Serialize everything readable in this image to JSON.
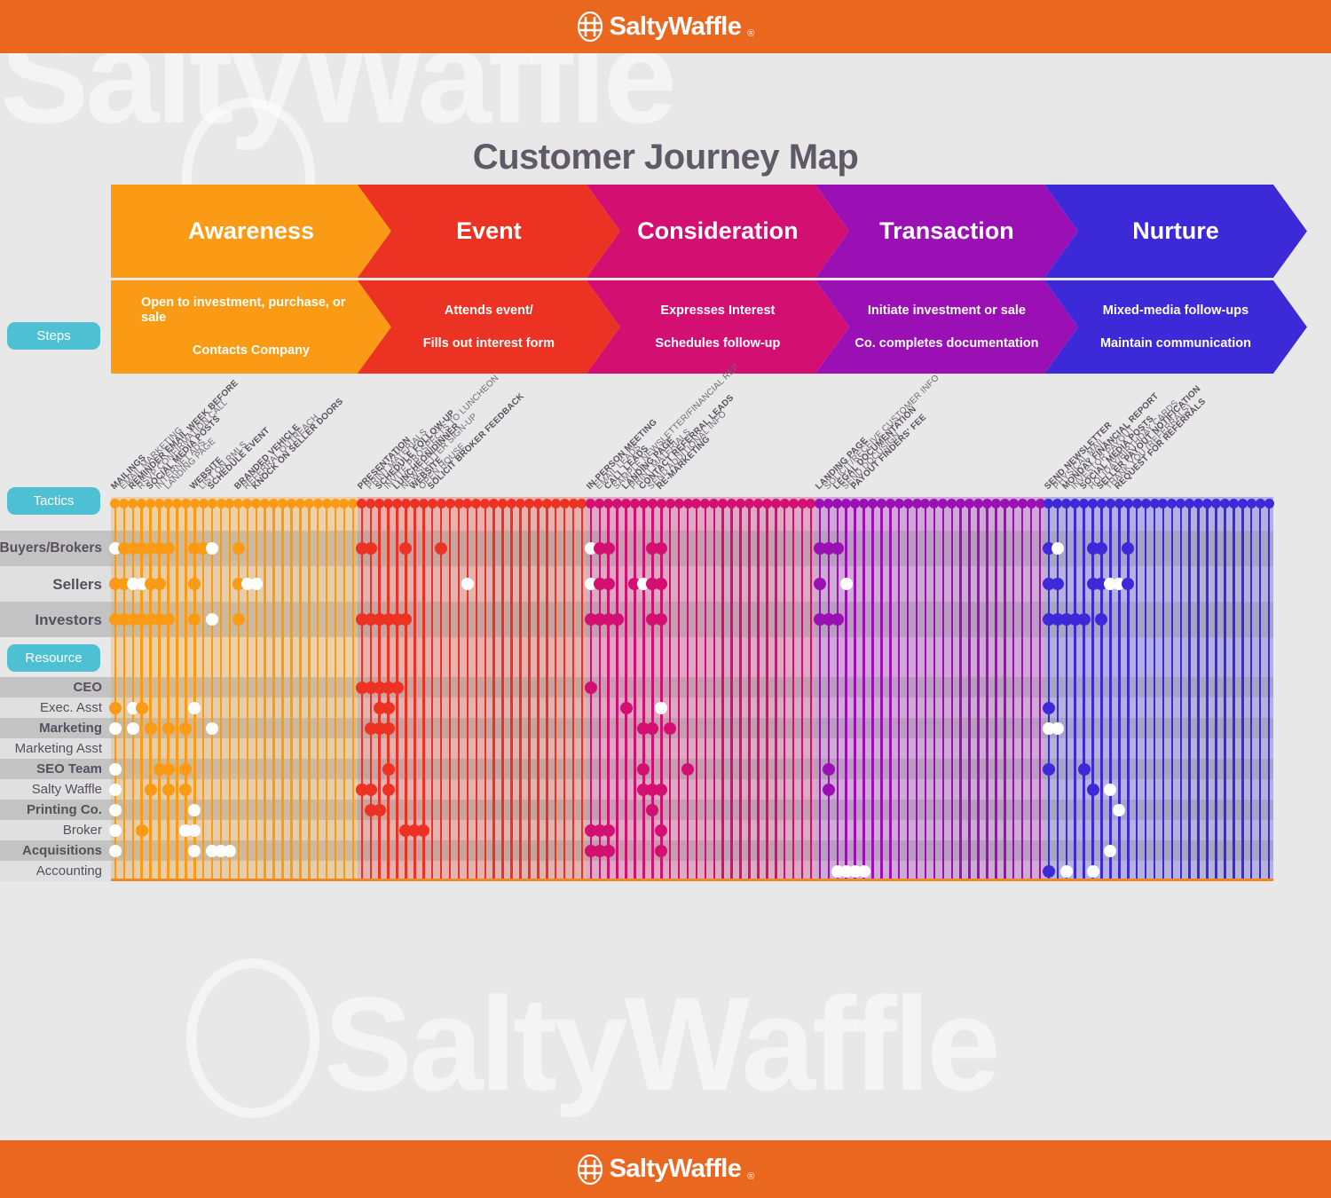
{
  "brand": {
    "name": "SaltyWaffle",
    "registered": "®",
    "bar_color": "#ea6720",
    "logo_icon": "hash-in-circle-icon"
  },
  "title": "Customer Journey Map",
  "left_pills": [
    {
      "key": "steps",
      "label": "Steps"
    },
    {
      "key": "tactics",
      "label": "Tactics"
    },
    {
      "key": "resource",
      "label": "Resource"
    }
  ],
  "stages": [
    {
      "name": "Awareness",
      "color": "#fb9a15",
      "sub": [
        "Open to investment, purchase, or sale",
        "Contacts Company"
      ]
    },
    {
      "name": "Event",
      "color": "#ec3223",
      "sub": [
        "Attends event/",
        "Fills out interest form"
      ]
    },
    {
      "name": "Consideration",
      "color": "#d30f72",
      "sub": [
        "Expresses Interest",
        "Schedules follow-up"
      ]
    },
    {
      "name": "Transaction",
      "color": "#9a10b5",
      "sub": [
        "Initiate investment or sale",
        "Co. completes documentation"
      ]
    },
    {
      "name": "Nurture",
      "color": "#3c2ad8",
      "sub": [
        "Mixed-media follow-ups",
        "Maintain communication"
      ]
    }
  ],
  "persona_rows": [
    {
      "label": "Buyers/Brokers",
      "shaded": true
    },
    {
      "label": "Sellers",
      "shaded": false
    },
    {
      "label": "Investors",
      "shaded": true
    }
  ],
  "resource_rows": [
    {
      "label": "CEO",
      "shaded": true,
      "bold": true
    },
    {
      "label": "Exec. Asst",
      "shaded": false,
      "bold": false
    },
    {
      "label": "Marketing",
      "shaded": true,
      "bold": true
    },
    {
      "label": "Marketing Asst",
      "shaded": false,
      "bold": false
    },
    {
      "label": "SEO Team",
      "shaded": true,
      "bold": true
    },
    {
      "label": "Salty Waffle",
      "shaded": false,
      "bold": false
    },
    {
      "label": "Printing Co.",
      "shaded": true,
      "bold": true
    },
    {
      "label": "Broker",
      "shaded": false,
      "bold": false
    },
    {
      "label": "Acquisitions",
      "shaded": true,
      "bold": true
    },
    {
      "label": "Accounting",
      "shaded": false,
      "bold": false
    }
  ],
  "chart_data": {
    "type": "heatmap",
    "title": "Customer Journey Map",
    "xlabel": "Tactics",
    "ylabel": "Personas and Resources",
    "legend_position": "none",
    "grid": true,
    "stage_columns": [
      {
        "stage": "Awareness",
        "columns": 28,
        "start_index": 0
      },
      {
        "stage": "Event",
        "columns": 26,
        "start_index": 28
      },
      {
        "stage": "Consideration",
        "columns": 26,
        "start_index": 54
      },
      {
        "stage": "Transaction",
        "columns": 26,
        "start_index": 80
      },
      {
        "stage": "Nurture",
        "columns": 26,
        "start_index": 106
      }
    ],
    "tactics": [
      {
        "stage": "Awareness",
        "index": 0,
        "label": "MAILINGS",
        "bold": true
      },
      {
        "stage": "Awareness",
        "index": 1,
        "label": "EMAIL MARKETING",
        "bold": false
      },
      {
        "stage": "Awareness",
        "index": 2,
        "label": "REMINDER EMAIL WEEK BEFORE",
        "bold": true
      },
      {
        "stage": "Awareness",
        "index": 3,
        "label": "RSVP CONFIRMATION CALL",
        "bold": false
      },
      {
        "stage": "Awareness",
        "index": 4,
        "label": "SOCIAL MEDIA POSTS",
        "bold": true
      },
      {
        "stage": "Awareness",
        "index": 5,
        "label": "INTERNET ADS",
        "bold": false
      },
      {
        "stage": "Awareness",
        "index": 6,
        "label": "LANDING PAGE",
        "bold": false
      },
      {
        "stage": "Awareness",
        "index": 9,
        "label": "WEBSITE",
        "bold": true
      },
      {
        "stage": "Awareness",
        "index": 10,
        "label": "LIST ON RMLS",
        "bold": false
      },
      {
        "stage": "Awareness",
        "index": 11,
        "label": "SCHEDULE EVENT",
        "bold": true
      },
      {
        "stage": "Awareness",
        "index": 14,
        "label": "BRANDED VEHICLE",
        "bold": true
      },
      {
        "stage": "Awareness",
        "index": 15,
        "label": "REFERRAL OUTREACH",
        "bold": false
      },
      {
        "stage": "Awareness",
        "index": 16,
        "label": "KNOCK ON SELLER DOORS",
        "bold": true
      },
      {
        "stage": "Event",
        "index": 0,
        "label": "PRESENTATION",
        "bold": true
      },
      {
        "stage": "Event",
        "index": 1,
        "label": "PRINT MATERIALS",
        "bold": false
      },
      {
        "stage": "Event",
        "index": 2,
        "label": "SCHEDULE FOLLOW-UP",
        "bold": true
      },
      {
        "stage": "Event",
        "index": 3,
        "label": "INVITE PROSPECTS TO LUNCHEON",
        "bold": false
      },
      {
        "stage": "Event",
        "index": 4,
        "label": "LUNCHEON/DINNER",
        "bold": true
      },
      {
        "stage": "Event",
        "index": 5,
        "label": "NEWSLETTER SIGN-UP",
        "bold": false
      },
      {
        "stage": "Event",
        "index": 6,
        "label": "WEBSITE",
        "bold": true
      },
      {
        "stage": "Event",
        "index": 7,
        "label": "OPEN HOUSE",
        "bold": false
      },
      {
        "stage": "Event",
        "index": 8,
        "label": "SOLICIT BROKER FEEDBACK",
        "bold": true
      },
      {
        "stage": "Consideration",
        "index": 0,
        "label": "IN-PERSON MEETING",
        "bold": true
      },
      {
        "stage": "Consideration",
        "index": 1,
        "label": "EMAIL LEADS",
        "bold": false
      },
      {
        "stage": "Consideration",
        "index": 2,
        "label": "CALL LEADS",
        "bold": true
      },
      {
        "stage": "Consideration",
        "index": 3,
        "label": "SAMPLE NEWSLETTER/FINANCIAL REP.",
        "bold": false
      },
      {
        "stage": "Consideration",
        "index": 4,
        "label": "LANDING PAGE",
        "bold": true
      },
      {
        "stage": "Consideration",
        "index": 5,
        "label": "PRINT MATERIALS",
        "bold": false
      },
      {
        "stage": "Consideration",
        "index": 6,
        "label": "CONTACT REFERRAL LEADS",
        "bold": true
      },
      {
        "stage": "Consideration",
        "index": 7,
        "label": "SEND ADDITIONAL INFO",
        "bold": false
      },
      {
        "stage": "Consideration",
        "index": 8,
        "label": "RE-MARKETING",
        "bold": true
      },
      {
        "stage": "Transaction",
        "index": 0,
        "label": "LANDING PAGE",
        "bold": true
      },
      {
        "stage": "Transaction",
        "index": 1,
        "label": "SOLICIT/RECEIVE CUSTOMER INFO",
        "bold": false
      },
      {
        "stage": "Transaction",
        "index": 2,
        "label": "LEGAL DOCUMENTATION",
        "bold": true
      },
      {
        "stage": "Transaction",
        "index": 3,
        "label": "SEND DOCUSIGN",
        "bold": false
      },
      {
        "stage": "Transaction",
        "index": 4,
        "label": "PAYOUT FINDERS' FEE",
        "bold": true
      },
      {
        "stage": "Nurture",
        "index": 0,
        "label": "SEND NEWSLETTER",
        "bold": true
      },
      {
        "stage": "Nurture",
        "index": 1,
        "label": "PHYSICAL MAIL",
        "bold": false
      },
      {
        "stage": "Nurture",
        "index": 2,
        "label": "MONDAY FINANCIAL REPORT",
        "bold": true
      },
      {
        "stage": "Nurture",
        "index": 3,
        "label": "INVESTOR PAYOUT",
        "bold": false
      },
      {
        "stage": "Nurture",
        "index": 4,
        "label": "SOCIAL MEDIA POSTS",
        "bold": true
      },
      {
        "stage": "Nurture",
        "index": 5,
        "label": "HOLIDAY/BIRTHDAY CARDS",
        "bold": false
      },
      {
        "stage": "Nurture",
        "index": 6,
        "label": "SELLER PAYOUT NOTIFICATION",
        "bold": true
      },
      {
        "stage": "Nurture",
        "index": 7,
        "label": "THANK YOU (REFERRALS)",
        "bold": false
      },
      {
        "stage": "Nurture",
        "index": 8,
        "label": "REQUEST FOR REFERRALS",
        "bold": true
      }
    ],
    "marks": {
      "Buyers/Brokers": [
        {
          "c": 0,
          "f": "hollow"
        },
        {
          "c": 1,
          "f": "solid"
        },
        {
          "c": 2,
          "f": "solid"
        },
        {
          "c": 3,
          "f": "solid"
        },
        {
          "c": 4,
          "f": "solid"
        },
        {
          "c": 5,
          "f": "solid"
        },
        {
          "c": 6,
          "f": "solid"
        },
        {
          "c": 9,
          "f": "solid"
        },
        {
          "c": 10,
          "f": "solid"
        },
        {
          "c": 11,
          "f": "hollow"
        },
        {
          "c": 14,
          "f": "solid"
        },
        {
          "c": 28,
          "f": "solid"
        },
        {
          "c": 29,
          "f": "solid"
        },
        {
          "c": 33,
          "f": "solid"
        },
        {
          "c": 37,
          "f": "solid"
        },
        {
          "c": 54,
          "f": "hollow"
        },
        {
          "c": 55,
          "f": "solid"
        },
        {
          "c": 56,
          "f": "solid"
        },
        {
          "c": 61,
          "f": "solid"
        },
        {
          "c": 62,
          "f": "solid"
        },
        {
          "c": 80,
          "f": "solid"
        },
        {
          "c": 81,
          "f": "solid"
        },
        {
          "c": 82,
          "f": "solid"
        },
        {
          "c": 106,
          "f": "solid"
        },
        {
          "c": 107,
          "f": "hollow"
        },
        {
          "c": 111,
          "f": "solid"
        },
        {
          "c": 112,
          "f": "solid"
        },
        {
          "c": 115,
          "f": "solid"
        }
      ],
      "Sellers": [
        {
          "c": 0,
          "f": "solid"
        },
        {
          "c": 1,
          "f": "solid"
        },
        {
          "c": 2,
          "f": "hollow"
        },
        {
          "c": 3,
          "f": "hollow"
        },
        {
          "c": 4,
          "f": "solid"
        },
        {
          "c": 5,
          "f": "solid"
        },
        {
          "c": 9,
          "f": "solid"
        },
        {
          "c": 14,
          "f": "solid"
        },
        {
          "c": 15,
          "f": "hollow"
        },
        {
          "c": 16,
          "f": "hollow"
        },
        {
          "c": 40,
          "f": "hollow"
        },
        {
          "c": 54,
          "f": "hollow"
        },
        {
          "c": 55,
          "f": "solid"
        },
        {
          "c": 56,
          "f": "solid"
        },
        {
          "c": 59,
          "f": "solid"
        },
        {
          "c": 60,
          "f": "hollow"
        },
        {
          "c": 61,
          "f": "solid"
        },
        {
          "c": 62,
          "f": "solid"
        },
        {
          "c": 80,
          "f": "solid"
        },
        {
          "c": 83,
          "f": "hollow"
        },
        {
          "c": 106,
          "f": "solid"
        },
        {
          "c": 107,
          "f": "solid"
        },
        {
          "c": 111,
          "f": "solid"
        },
        {
          "c": 112,
          "f": "solid"
        },
        {
          "c": 113,
          "f": "hollow"
        },
        {
          "c": 114,
          "f": "hollow"
        },
        {
          "c": 115,
          "f": "solid"
        }
      ],
      "Investors": [
        {
          "c": 0,
          "f": "solid"
        },
        {
          "c": 1,
          "f": "solid"
        },
        {
          "c": 2,
          "f": "solid"
        },
        {
          "c": 3,
          "f": "solid"
        },
        {
          "c": 4,
          "f": "solid"
        },
        {
          "c": 5,
          "f": "solid"
        },
        {
          "c": 6,
          "f": "solid"
        },
        {
          "c": 9,
          "f": "solid"
        },
        {
          "c": 11,
          "f": "hollow"
        },
        {
          "c": 14,
          "f": "solid"
        },
        {
          "c": 28,
          "f": "solid"
        },
        {
          "c": 29,
          "f": "solid"
        },
        {
          "c": 30,
          "f": "solid"
        },
        {
          "c": 31,
          "f": "solid"
        },
        {
          "c": 32,
          "f": "solid"
        },
        {
          "c": 33,
          "f": "solid"
        },
        {
          "c": 54,
          "f": "solid"
        },
        {
          "c": 55,
          "f": "solid"
        },
        {
          "c": 56,
          "f": "solid"
        },
        {
          "c": 57,
          "f": "solid"
        },
        {
          "c": 61,
          "f": "solid"
        },
        {
          "c": 62,
          "f": "solid"
        },
        {
          "c": 80,
          "f": "solid"
        },
        {
          "c": 81,
          "f": "solid"
        },
        {
          "c": 82,
          "f": "solid"
        },
        {
          "c": 106,
          "f": "solid"
        },
        {
          "c": 107,
          "f": "solid"
        },
        {
          "c": 108,
          "f": "solid"
        },
        {
          "c": 109,
          "f": "solid"
        },
        {
          "c": 110,
          "f": "solid"
        },
        {
          "c": 112,
          "f": "solid"
        }
      ],
      "CEO": [
        {
          "c": 28,
          "f": "solid"
        },
        {
          "c": 29,
          "f": "solid"
        },
        {
          "c": 30,
          "f": "solid"
        },
        {
          "c": 31,
          "f": "solid"
        },
        {
          "c": 32,
          "f": "solid"
        },
        {
          "c": 54,
          "f": "solid"
        }
      ],
      "Exec. Asst": [
        {
          "c": 0,
          "f": "solid"
        },
        {
          "c": 2,
          "f": "hollow"
        },
        {
          "c": 3,
          "f": "solid"
        },
        {
          "c": 9,
          "f": "hollow"
        },
        {
          "c": 30,
          "f": "solid"
        },
        {
          "c": 31,
          "f": "solid"
        },
        {
          "c": 58,
          "f": "solid"
        },
        {
          "c": 62,
          "f": "hollow"
        },
        {
          "c": 106,
          "f": "solid"
        }
      ],
      "Marketing": [
        {
          "c": 0,
          "f": "hollow"
        },
        {
          "c": 2,
          "f": "hollow"
        },
        {
          "c": 4,
          "f": "solid"
        },
        {
          "c": 6,
          "f": "solid"
        },
        {
          "c": 8,
          "f": "solid"
        },
        {
          "c": 11,
          "f": "hollow"
        },
        {
          "c": 29,
          "f": "solid"
        },
        {
          "c": 30,
          "f": "solid"
        },
        {
          "c": 31,
          "f": "solid"
        },
        {
          "c": 60,
          "f": "solid"
        },
        {
          "c": 61,
          "f": "solid"
        },
        {
          "c": 63,
          "f": "solid"
        },
        {
          "c": 106,
          "f": "hollow"
        },
        {
          "c": 107,
          "f": "hollow"
        }
      ],
      "Marketing Asst": [],
      "SEO Team": [
        {
          "c": 0,
          "f": "hollow"
        },
        {
          "c": 5,
          "f": "solid"
        },
        {
          "c": 6,
          "f": "solid"
        },
        {
          "c": 8,
          "f": "solid"
        },
        {
          "c": 31,
          "f": "solid"
        },
        {
          "c": 60,
          "f": "solid"
        },
        {
          "c": 65,
          "f": "solid"
        },
        {
          "c": 81,
          "f": "solid"
        },
        {
          "c": 106,
          "f": "solid"
        },
        {
          "c": 110,
          "f": "solid"
        }
      ],
      "Salty Waffle": [
        {
          "c": 0,
          "f": "hollow"
        },
        {
          "c": 4,
          "f": "solid"
        },
        {
          "c": 6,
          "f": "solid"
        },
        {
          "c": 8,
          "f": "solid"
        },
        {
          "c": 28,
          "f": "solid"
        },
        {
          "c": 29,
          "f": "solid"
        },
        {
          "c": 31,
          "f": "solid"
        },
        {
          "c": 60,
          "f": "solid"
        },
        {
          "c": 61,
          "f": "solid"
        },
        {
          "c": 62,
          "f": "solid"
        },
        {
          "c": 81,
          "f": "solid"
        },
        {
          "c": 111,
          "f": "solid"
        },
        {
          "c": 113,
          "f": "hollow"
        }
      ],
      "Printing Co.": [
        {
          "c": 0,
          "f": "hollow"
        },
        {
          "c": 9,
          "f": "hollow"
        },
        {
          "c": 29,
          "f": "solid"
        },
        {
          "c": 30,
          "f": "solid"
        },
        {
          "c": 61,
          "f": "solid"
        },
        {
          "c": 114,
          "f": "hollow"
        }
      ],
      "Broker": [
        {
          "c": 0,
          "f": "hollow"
        },
        {
          "c": 3,
          "f": "solid"
        },
        {
          "c": 8,
          "f": "hollow"
        },
        {
          "c": 9,
          "f": "hollow"
        },
        {
          "c": 33,
          "f": "solid"
        },
        {
          "c": 34,
          "f": "solid"
        },
        {
          "c": 35,
          "f": "solid"
        },
        {
          "c": 54,
          "f": "solid"
        },
        {
          "c": 55,
          "f": "solid"
        },
        {
          "c": 56,
          "f": "solid"
        },
        {
          "c": 62,
          "f": "solid"
        }
      ],
      "Acquisitions": [
        {
          "c": 0,
          "f": "hollow"
        },
        {
          "c": 9,
          "f": "hollow"
        },
        {
          "c": 11,
          "f": "hollow"
        },
        {
          "c": 12,
          "f": "hollow"
        },
        {
          "c": 13,
          "f": "hollow"
        },
        {
          "c": 54,
          "f": "solid"
        },
        {
          "c": 55,
          "f": "solid"
        },
        {
          "c": 56,
          "f": "solid"
        },
        {
          "c": 62,
          "f": "solid"
        },
        {
          "c": 113,
          "f": "hollow"
        }
      ],
      "Accounting": [
        {
          "c": 82,
          "f": "hollow"
        },
        {
          "c": 83,
          "f": "hollow"
        },
        {
          "c": 84,
          "f": "hollow"
        },
        {
          "c": 85,
          "f": "hollow"
        },
        {
          "c": 106,
          "f": "solid"
        },
        {
          "c": 108,
          "f": "hollow"
        },
        {
          "c": 111,
          "f": "hollow"
        }
      ]
    }
  }
}
